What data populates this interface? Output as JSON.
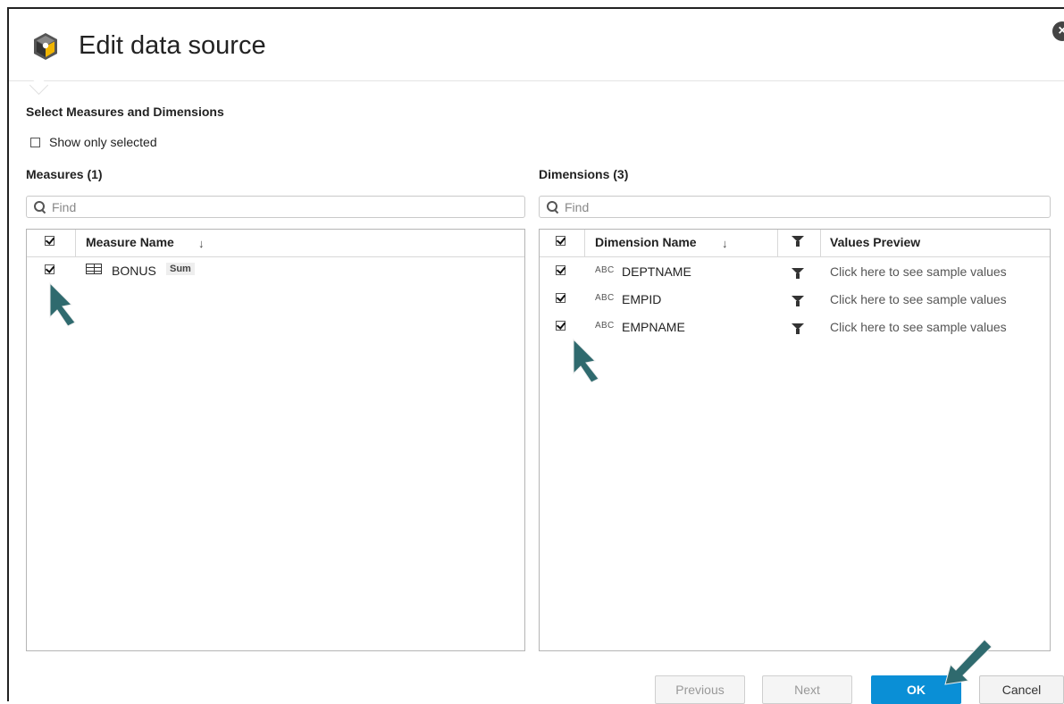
{
  "dialog": {
    "title": "Edit data source",
    "close_symbol": "×"
  },
  "section_title": "Select Measures and Dimensions",
  "show_only_selected": {
    "label": "Show only selected",
    "checked": false
  },
  "measures": {
    "label": "Measures (1)",
    "find_placeholder": "Find",
    "column_name": "Measure Name",
    "rows": [
      {
        "name": "BONUS",
        "aggregation": "Sum",
        "checked": true
      }
    ]
  },
  "dimensions": {
    "label": "Dimensions (3)",
    "find_placeholder": "Find",
    "column_name": "Dimension Name",
    "column_preview": "Values Preview",
    "type_label": "ABC",
    "rows": [
      {
        "name": "DEPTNAME",
        "preview": "Click here to see sample values",
        "checked": true
      },
      {
        "name": "EMPID",
        "preview": "Click here to see sample values",
        "checked": true
      },
      {
        "name": "EMPNAME",
        "preview": "Click here to see sample values",
        "checked": true
      }
    ]
  },
  "buttons": {
    "previous": "Previous",
    "next": "Next",
    "ok": "OK",
    "cancel": "Cancel"
  },
  "colors": {
    "primary": "#0a8fd6",
    "pointer": "#2f6a6e"
  }
}
